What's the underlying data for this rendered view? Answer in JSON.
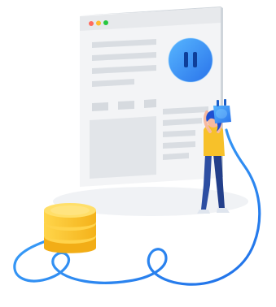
{
  "illustration": {
    "window_controls": [
      "close-dot",
      "minimize-dot",
      "maximize-dot"
    ],
    "hero_icon": "pause-icon",
    "database_icon": "database-stack-icon",
    "person": "person-holding-plug",
    "cable": "cable-plug-icon"
  },
  "colors": {
    "window_dot_red": "#ff6b5e",
    "window_dot_yellow": "#ffbd2e",
    "window_dot_green": "#28c840",
    "accent_blue": "#2f8cf0",
    "cable_blue": "#3aa6f5",
    "database_yellow": "#f9c631",
    "skin": "#f6b9a0",
    "shirt": "#f7c12a",
    "pants": "#2d4ea2",
    "hair": "#1f4fd1"
  }
}
